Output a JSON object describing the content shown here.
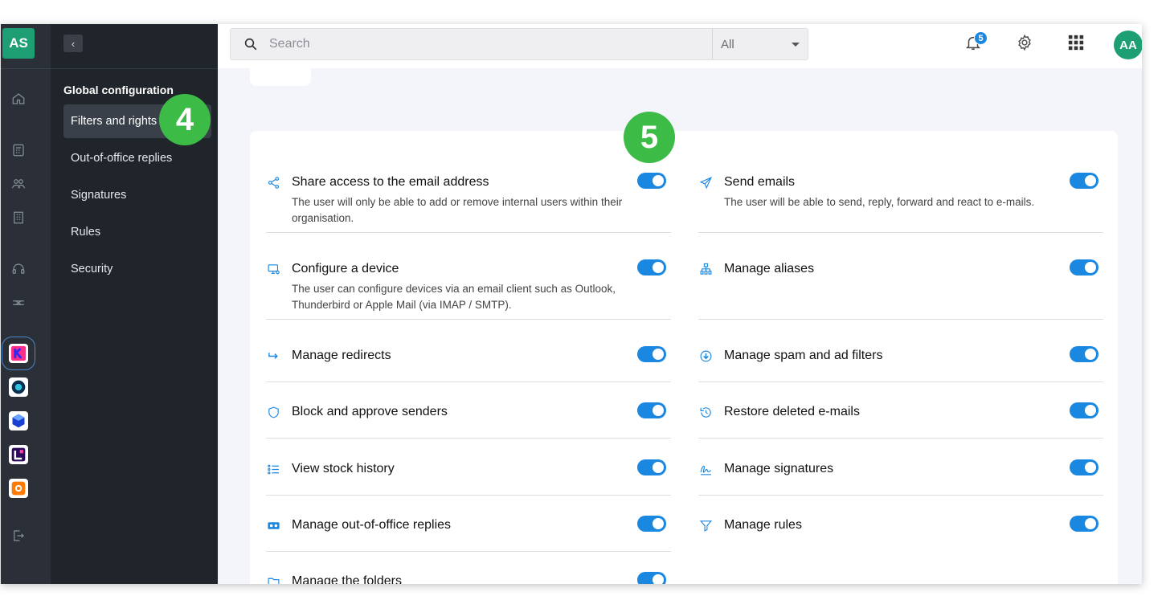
{
  "rail": {
    "account_initials": "AS",
    "icons": [
      "home-icon",
      "calendar-icon",
      "users-icon",
      "building-icon",
      "headset-icon",
      "network-icon"
    ],
    "apps": [
      "kmail-app",
      "kdrive-app",
      "kchat-app",
      "swisstransfer-app",
      "euria-app"
    ],
    "logout_icon": "logout-icon"
  },
  "sidebar": {
    "collapse_label": "‹",
    "section_title": "Global configuration",
    "items": [
      {
        "label": "Filters and rights",
        "active": true
      },
      {
        "label": "Out-of-office replies",
        "active": false
      },
      {
        "label": "Signatures",
        "active": false
      },
      {
        "label": "Rules",
        "active": false
      },
      {
        "label": "Security",
        "active": false
      }
    ]
  },
  "topbar": {
    "search_placeholder": "Search",
    "search_scope": "All",
    "notifications_count": "5",
    "user_initials": "AA"
  },
  "steps": {
    "step4": "4",
    "step5": "5"
  },
  "permissions": {
    "left": [
      {
        "title": "Share access to the email address",
        "desc": "The user will only be able to add or remove internal users within their organisation.",
        "enabled": true,
        "icon": "share-icon"
      },
      {
        "title": "Configure a device",
        "desc": "The user can configure devices via an email client such as Outlook, Thunderbird or Apple Mail (via IMAP / SMTP).",
        "enabled": true,
        "icon": "device-icon"
      },
      {
        "title": "Manage redirects",
        "desc": "",
        "enabled": true,
        "icon": "redirect-icon"
      },
      {
        "title": "Block and approve senders",
        "desc": "",
        "enabled": true,
        "icon": "shield-icon"
      },
      {
        "title": "View stock history",
        "desc": "",
        "enabled": true,
        "icon": "list-icon"
      },
      {
        "title": "Manage out-of-office replies",
        "desc": "",
        "enabled": true,
        "icon": "out-of-office-icon"
      },
      {
        "title": "Manage the folders",
        "desc": "",
        "enabled": true,
        "icon": "folder-icon"
      }
    ],
    "right": [
      {
        "title": "Send emails",
        "desc": "The user will be able to send, reply, forward and react to e-mails.",
        "enabled": true,
        "icon": "send-icon"
      },
      {
        "title": "Manage aliases",
        "desc": "",
        "enabled": true,
        "icon": "alias-icon"
      },
      {
        "title": "Manage spam and ad filters",
        "desc": "",
        "enabled": true,
        "icon": "spam-filter-icon"
      },
      {
        "title": "Restore deleted e-mails",
        "desc": "",
        "enabled": true,
        "icon": "restore-icon"
      },
      {
        "title": "Manage signatures",
        "desc": "",
        "enabled": true,
        "icon": "signature-icon"
      },
      {
        "title": "Manage rules",
        "desc": "",
        "enabled": true,
        "icon": "funnel-icon"
      }
    ]
  },
  "colors": {
    "accent": "#1a87e0",
    "step_marker": "#3dbb47",
    "avatar": "#1e9e73",
    "sidebar_bg": "#20242b",
    "rail_bg": "#2b3038"
  }
}
